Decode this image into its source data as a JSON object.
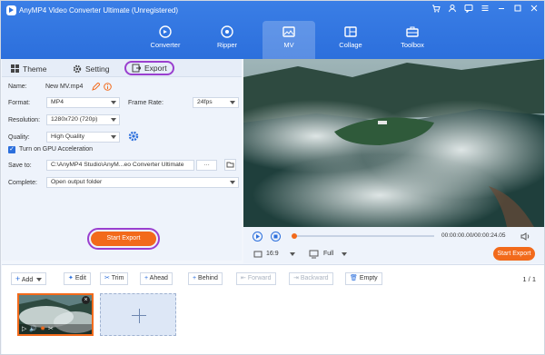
{
  "app": {
    "title": "AnyMP4 Video Converter Ultimate (Unregistered)"
  },
  "nav": [
    {
      "label": "Converter",
      "icon": "converter-icon"
    },
    {
      "label": "Ripper",
      "icon": "ripper-icon"
    },
    {
      "label": "MV",
      "icon": "mv-icon",
      "active": true
    },
    {
      "label": "Collage",
      "icon": "collage-icon"
    },
    {
      "label": "Toolbox",
      "icon": "toolbox-icon"
    }
  ],
  "tabs": {
    "theme": "Theme",
    "setting": "Setting",
    "export": "Export"
  },
  "export": {
    "name_label": "Name:",
    "name_value": "New MV.mp4",
    "format_label": "Format:",
    "format_value": "MP4",
    "frame_rate_label": "Frame Rate:",
    "frame_rate_value": "24fps",
    "resolution_label": "Resolution:",
    "resolution_value": "1280x720 (720p)",
    "quality_label": "Quality:",
    "quality_value": "High Quality",
    "gpu_label": "Turn on GPU Acceleration",
    "save_to_label": "Save to:",
    "save_to_value": "C:\\AnyMP4 Studio\\AnyM...eo Converter Ultimate",
    "save_to_more": "···",
    "complete_label": "Complete:",
    "complete_value": "Open output folder",
    "start_button": "Start Export"
  },
  "player": {
    "time": "00:00:00.00/00:00:24.05",
    "aspect": "16:9",
    "view": "Full",
    "export_button": "Start Export"
  },
  "toolbar": {
    "add": "Add",
    "edit": "Edit",
    "trim": "Trim",
    "ahead": "Ahead",
    "behind": "Behind",
    "forward": "Forward",
    "backward": "Backward",
    "empty": "Empty",
    "page": "1 / 1"
  },
  "colors": {
    "accent": "#2c6fdc",
    "orange": "#f26a1b",
    "highlight": "#9a3fcf"
  }
}
